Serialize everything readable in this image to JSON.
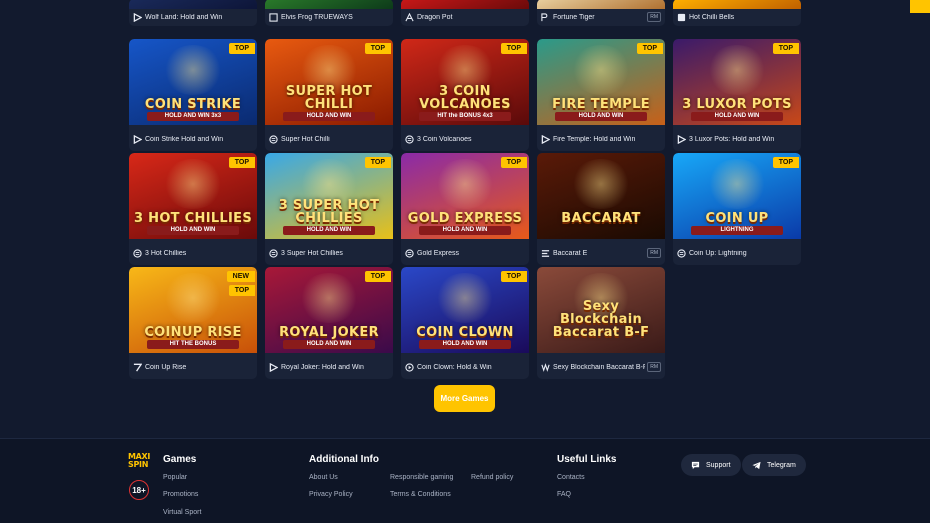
{
  "games": [
    {
      "name": "Wolf Land: Hold and Win",
      "provider": "play-icon",
      "row": 0,
      "col": 0,
      "partial": true,
      "bg": [
        "#1a2a5a",
        "#0d1538"
      ],
      "art": ""
    },
    {
      "name": "Elvis Frog TRUEWAYS",
      "provider": "bgaming-logo",
      "row": 0,
      "col": 1,
      "partial": true,
      "bg": [
        "#2a7a2a",
        "#0d3a1a"
      ],
      "art": ""
    },
    {
      "name": "Dragon Pot",
      "provider": "amatic-logo",
      "row": 0,
      "col": 2,
      "partial": true,
      "bg": [
        "#c81818",
        "#6a0a0a"
      ],
      "art": ""
    },
    {
      "name": "Fortune Tiger",
      "provider": "pg-logo",
      "row": 0,
      "col": 3,
      "partial": true,
      "bg": [
        "#e8d0a0",
        "#b07030"
      ],
      "art": "",
      "rm": "RM"
    },
    {
      "name": "Hot Chilli Bells",
      "provider": "booongo-logo",
      "row": 0,
      "col": 4,
      "partial": true,
      "bg": [
        "#ffb000",
        "#c06000"
      ],
      "art": ""
    },
    {
      "name": "Coin Strike Hold and Win",
      "provider": "play-icon",
      "row": 1,
      "col": 0,
      "badge": "TOP",
      "bg": [
        "#1656c8",
        "#0a2a70"
      ],
      "art": "COIN STRIKE",
      "sub": "HOLD AND WIN 3x3"
    },
    {
      "name": "Super Hot Chilli",
      "provider": "3oaks-logo",
      "row": 1,
      "col": 1,
      "badge": "TOP",
      "bg": [
        "#e85a10",
        "#8a1a00"
      ],
      "art": "SUPER HOT CHILLI",
      "sub": "HOLD AND WIN"
    },
    {
      "name": "3 Coin Volcanoes",
      "provider": "3oaks-logo",
      "row": 1,
      "col": 2,
      "badge": "TOP",
      "bg": [
        "#d02818",
        "#5a0a0a"
      ],
      "art": "3 COIN VOLCANOES",
      "sub": "HIT the BONUS 4x3"
    },
    {
      "name": "Fire Temple: Hold and Win",
      "provider": "play-icon",
      "row": 1,
      "col": 3,
      "badge": "TOP",
      "bg": [
        "#2a9a8a",
        "#c86018"
      ],
      "art": "FIRE TEMPLE",
      "sub": "HOLD AND WIN"
    },
    {
      "name": "3 Luxor Pots: Hold and Win",
      "provider": "play-icon",
      "row": 1,
      "col": 4,
      "badge": "TOP",
      "bg": [
        "#3a1a6a",
        "#c84818"
      ],
      "art": "3 LUXOR POTS",
      "sub": "HOLD AND WIN"
    },
    {
      "name": "3 Hot Chillies",
      "provider": "3oaks-logo",
      "row": 2,
      "col": 0,
      "badge": "TOP",
      "bg": [
        "#d82818",
        "#6a0a0a"
      ],
      "art": "3 HOT CHILLIES",
      "sub": "HOLD AND WIN"
    },
    {
      "name": "3 Super Hot Chillies",
      "provider": "3oaks-logo",
      "row": 2,
      "col": 1,
      "badge": "TOP",
      "bg": [
        "#38a8e8",
        "#e8c018"
      ],
      "art": "3 SUPER HOT CHILLIES",
      "sub": "HOLD AND WIN"
    },
    {
      "name": "Gold Express",
      "provider": "3oaks-logo",
      "row": 2,
      "col": 2,
      "badge": "TOP",
      "bg": [
        "#8a2aa8",
        "#e85a18"
      ],
      "art": "GOLD EXPRESS",
      "sub": "HOLD AND WIN"
    },
    {
      "name": "Baccarat E",
      "provider": "ezugi-logo",
      "row": 2,
      "col": 3,
      "bg": [
        "#5a1a08",
        "#1a0a02"
      ],
      "art": "BACCARAT",
      "sub": "",
      "rm": "RM"
    },
    {
      "name": "Coin Up: Lightning",
      "provider": "3oaks-logo",
      "row": 2,
      "col": 4,
      "badge": "TOP",
      "bg": [
        "#18a8f8",
        "#0a3aa8"
      ],
      "art": "COIN UP",
      "sub": "LIGHTNING"
    },
    {
      "name": "Coin Up Rise",
      "provider": "7-logo",
      "row": 3,
      "col": 0,
      "badge": "NEW",
      "badge2": "TOP",
      "bg": [
        "#f8b818",
        "#c85008"
      ],
      "art": "COINUP RISE",
      "sub": "HIT THE BONUS"
    },
    {
      "name": "Royal Joker: Hold and Win",
      "provider": "play-icon",
      "row": 3,
      "col": 1,
      "badge": "TOP",
      "bg": [
        "#a81838",
        "#3a0a4a"
      ],
      "art": "ROYAL JOKER",
      "sub": "HOLD AND WIN"
    },
    {
      "name": "Coin Clown: Hold & Win",
      "provider": "circle-play-icon",
      "row": 3,
      "col": 2,
      "badge": "TOP",
      "bg": [
        "#2a48c8",
        "#1a0a5a"
      ],
      "art": "COIN CLOWN",
      "sub": "HOLD AND WIN"
    },
    {
      "name": "Sexy Blockchain Baccarat B-F",
      "provider": "sexy-logo",
      "row": 3,
      "col": 3,
      "bg": [
        "#8a4a3a",
        "#3a1a18"
      ],
      "art": "Sexy Blockchain Baccarat B-F",
      "sub": "",
      "rm": "RM"
    }
  ],
  "more_button": "More Games",
  "footer": {
    "logo": "MAXI SPIN",
    "age": "18+",
    "games_title": "Games",
    "games_links": [
      "Popular",
      "Promotions",
      "Virtual Sport"
    ],
    "info_title": "Additional Info",
    "info_links": [
      "About Us",
      "Privacy Policy",
      "Responsible gaming",
      "Terms & Conditions",
      "Refund policy"
    ],
    "useful_title": "Useful Links",
    "useful_links": [
      "Contacts",
      "FAQ"
    ],
    "support": "Support",
    "telegram": "Telegram"
  },
  "colors": {
    "accent": "#ffc400",
    "background": "#121a2e",
    "footer": "#0e1526"
  }
}
